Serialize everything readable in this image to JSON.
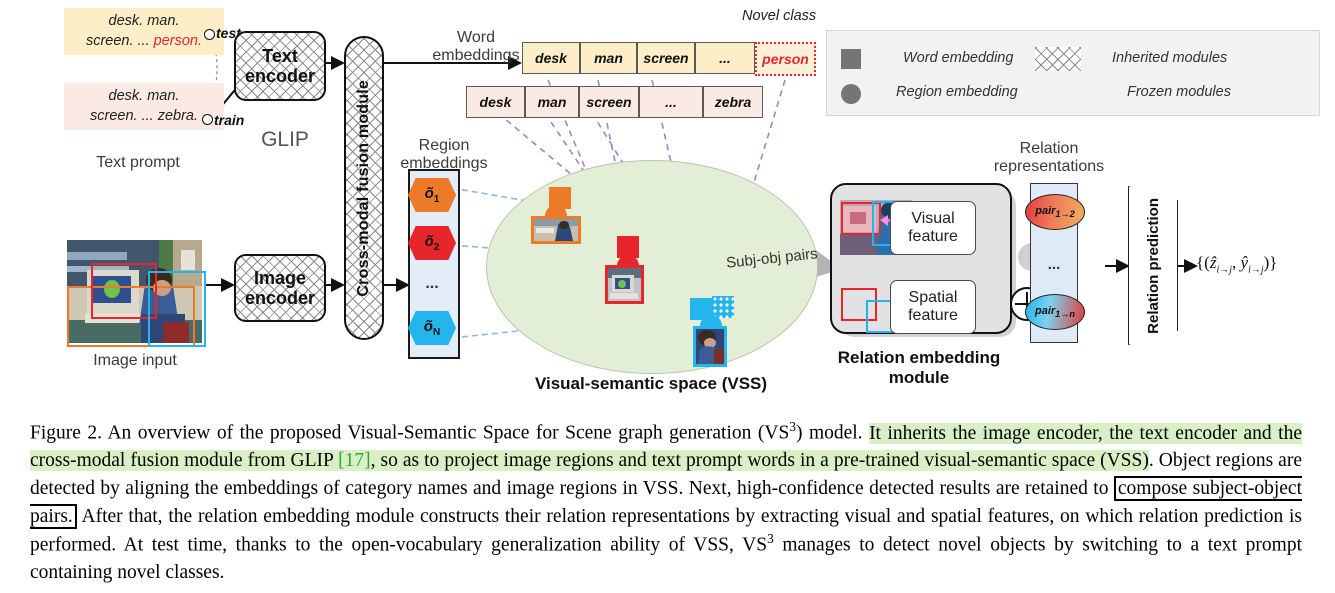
{
  "figure": {
    "text_prompt": {
      "test_box": {
        "line1": "desk. man.",
        "line2_a": "screen. ... ",
        "line2_b": "person."
      },
      "train_box": {
        "line1": "desk. man.",
        "line2": "screen. ...  zebra."
      },
      "test_node_label": "test",
      "train_node_label": "train",
      "caption_label": "Text prompt"
    },
    "glip_label": "GLIP",
    "text_encoder_label": "Text\nencoder",
    "image_encoder_label": "Image\nencoder",
    "image_input_label": "Image input",
    "fusion_module_label": "Cross-modal fusion module",
    "word_embeddings_label": "Word\nembeddings",
    "novel_class_label": "Novel class",
    "word_row_test": [
      "desk",
      "man",
      "screen",
      "...",
      "person"
    ],
    "word_row_train": [
      "desk",
      "man",
      "screen",
      "...",
      "zebra"
    ],
    "region_embeddings_label": "Region\nembeddings",
    "region_tokens": [
      {
        "text": "õ",
        "sub": "1",
        "color": "#ec7a28"
      },
      {
        "text": "õ",
        "sub": "2",
        "color": "#e8252a"
      },
      {
        "text": "...",
        "sub": "",
        "color": ""
      },
      {
        "text": "õ",
        "sub": "N",
        "color": "#23b5ec"
      }
    ],
    "vss_label": "Visual-semantic space (VSS)",
    "subj_obj_label": "Subj-obj pairs",
    "relation_module": {
      "title": "Relation embedding module",
      "visual_feature": "Visual\nfeature",
      "spatial_feature": "Spatial\nfeature"
    },
    "relation_representations_label": "Relation\nrepresentations",
    "pairs": [
      "pair₁→₂",
      "...",
      "pair₁→ₙ"
    ],
    "relation_prediction_label": "Relation prediction",
    "output_label": "{(ẑᵢ→ⱼ, ŷᵢ→ⱼ)}",
    "legend": [
      {
        "icon": "square-swatch",
        "text": "Word embedding"
      },
      {
        "icon": "hatched-swatch",
        "text": "Inherited modules"
      },
      {
        "icon": "circle-swatch",
        "text": "Region embedding"
      },
      {
        "icon": "lock-icon",
        "text": "Frozen modules"
      }
    ],
    "colors": {
      "orange": "#ec7a28",
      "red": "#e8252a",
      "blue": "#23b5ec",
      "vss_fill": "#e3eed6",
      "highlight": "#d9f0c4",
      "citation": "#2fa82f",
      "prompt_test_bg": "#fdeec8",
      "prompt_train_bg": "#fbeae3"
    }
  },
  "caption": {
    "p1": "Figure 2. An overview of the proposed Visual-Semantic Space for Scene graph generation (VS",
    "p1_sup": "3",
    "p2": ") model. ",
    "hl1": "It inherits the image encoder, the text encoder and the cross-modal fusion module from GLIP ",
    "cite": "[17]",
    "hl2": ", so as to project image regions and text prompt words in a pre-trained visual-semantic space (VSS)",
    "p3": ". Object regions are detected by aligning the embeddings of category names and image regions in VSS. Next, high-confidence detected results are retained to ",
    "boxed": "compose subject-object pairs.",
    "p4": " After that, the relation embedding module constructs their relation representations by extracting visual and spatial features, on which relation prediction is performed. At test time, thanks to the open-vocabulary generalization ability of VSS, VS",
    "p4_sup": "3",
    "p5": " manages to detect novel objects by switching to a text prompt containing novel classes."
  }
}
